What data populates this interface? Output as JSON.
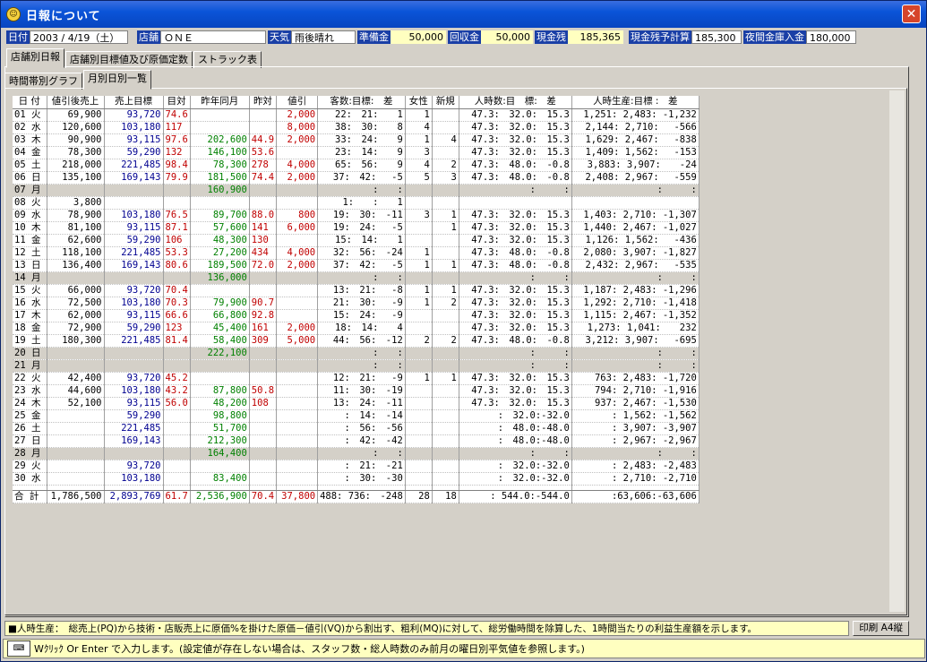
{
  "window": {
    "title": "日報について",
    "close": "✕",
    "icon": "☺"
  },
  "info": [
    {
      "label": "日付",
      "value": "2003 / 4/19（土）",
      "style": "val",
      "w": 110
    },
    {
      "label": "店舗",
      "value": "ＯＮＥ",
      "style": "val",
      "w": 118
    },
    {
      "label": "天気",
      "value": "雨後晴れ",
      "style": "val",
      "w": 72
    },
    {
      "label": "準備金",
      "value": "50,000",
      "style": "valy",
      "w": 62
    },
    {
      "label": "回収金",
      "value": "50,000",
      "style": "valy",
      "w": 58
    },
    {
      "label": "現金残",
      "value": "185,365",
      "style": "valy",
      "w": 62
    },
    {
      "label": "現金残予計算",
      "value": "185,300",
      "style": "val",
      "w": 56
    },
    {
      "label": "夜間金庫入金",
      "value": "180,000",
      "style": "val",
      "w": 56
    }
  ],
  "tabs1": [
    "店舗別日報",
    "店舗別目標値及び原価定数",
    "ストラック表"
  ],
  "tabs2": [
    "時間帯別グラフ",
    "月別日別一覧"
  ],
  "columns": [
    "日 付",
    "値引後売上",
    "売上目標",
    "目対",
    "昨年同月",
    "昨対",
    "値引",
    "客数:目標:　差",
    "女性",
    "新規",
    "人時数:目　標:　差",
    "人時生産:目標 :　差"
  ],
  "rows": [
    [
      "01 火",
      "69,900",
      "93,720",
      "74.6",
      "",
      "",
      "2,000",
      "22:　21:　　1",
      "1",
      "",
      "47.3:　32.0:　15.3",
      "1,251: 2,483: -1,232",
      ""
    ],
    [
      "02 水",
      "120,600",
      "103,180",
      "117",
      "",
      "",
      "8,000",
      "38:　30:　　8",
      "4",
      "",
      "47.3:　32.0:　15.3",
      "2,144: 2,710:　 -566",
      ""
    ],
    [
      "03 木",
      "90,900",
      "93,115",
      "97.6",
      "202,600",
      "44.9",
      "2,000",
      "33:　24:　　9",
      "1",
      "4",
      "47.3:　32.0:　15.3",
      "1,629: 2,467:　 -838",
      ""
    ],
    [
      "04 金",
      "78,300",
      "59,290",
      "132",
      "146,100",
      "53.6",
      "",
      "23:　14:　　9",
      "3",
      "",
      "47.3:　32.0:　15.3",
      "1,409: 1,562:　 -153",
      ""
    ],
    [
      "05 土",
      "218,000",
      "221,485",
      "98.4",
      "78,300",
      "278",
      "4,000",
      "65:　56:　　9",
      "4",
      "2",
      "47.3:　48.0:　-0.8",
      "3,883: 3,907:　　-24",
      ""
    ],
    [
      "06 日",
      "135,100",
      "169,143",
      "79.9",
      "181,500",
      "74.4",
      "2,000",
      "37:　42:　 -5",
      "5",
      "3",
      "47.3:　48.0:　-0.8",
      "2,408: 2,967:　 -559",
      ""
    ],
    [
      "07 月",
      "",
      "",
      "",
      "160,900",
      "",
      "",
      "　:　　:",
      "",
      "",
      "　　　:　　　:",
      "　　　:　　　:",
      "gray"
    ],
    [
      "08 火",
      "3,800",
      "",
      "",
      "",
      "",
      "",
      "1:　　:　　1",
      "",
      "",
      "",
      "",
      ""
    ],
    [
      "09 水",
      "78,900",
      "103,180",
      "76.5",
      "89,700",
      "88.0",
      "800",
      "19:　30:　-11",
      "3",
      "1",
      "47.3:　32.0:　15.3",
      "1,403: 2,710: -1,307",
      ""
    ],
    [
      "10 木",
      "81,100",
      "93,115",
      "87.1",
      "57,600",
      "141",
      "6,000",
      "19:　24:　 -5",
      "",
      "1",
      "47.3:　32.0:　15.3",
      "1,440: 2,467: -1,027",
      ""
    ],
    [
      "11 金",
      "62,600",
      "59,290",
      "106",
      "48,300",
      "130",
      "",
      "15:　14:　　1",
      "",
      "",
      "47.3:　32.0:　15.3",
      "1,126: 1,562:　 -436",
      ""
    ],
    [
      "12 土",
      "118,100",
      "221,485",
      "53.3",
      "27,200",
      "434",
      "4,000",
      "32:　56:　-24",
      "1",
      "",
      "47.3:　48.0:　-0.8",
      "2,080: 3,907: -1,827",
      ""
    ],
    [
      "13 日",
      "136,400",
      "169,143",
      "80.6",
      "189,500",
      "72.0",
      "2,000",
      "37:　42:　 -5",
      "1",
      "1",
      "47.3:　48.0:　-0.8",
      "2,432: 2,967:　 -535",
      ""
    ],
    [
      "14 月",
      "",
      "",
      "",
      "136,000",
      "",
      "",
      "　:　　:",
      "",
      "",
      "　　　:　　　:",
      "　　　:　　　:",
      "gray"
    ],
    [
      "15 火",
      "66,000",
      "93,720",
      "70.4",
      "",
      "",
      "",
      "13:　21:　 -8",
      "1",
      "1",
      "47.3:　32.0:　15.3",
      "1,187: 2,483: -1,296",
      ""
    ],
    [
      "16 水",
      "72,500",
      "103,180",
      "70.3",
      "79,900",
      "90.7",
      "",
      "21:　30:　 -9",
      "1",
      "2",
      "47.3:　32.0:　15.3",
      "1,292: 2,710: -1,418",
      ""
    ],
    [
      "17 木",
      "62,000",
      "93,115",
      "66.6",
      "66,800",
      "92.8",
      "",
      "15:　24:　 -9",
      "",
      "",
      "47.3:　32.0:　15.3",
      "1,115: 2,467: -1,352",
      ""
    ],
    [
      "18 金",
      "72,900",
      "59,290",
      "123",
      "45,400",
      "161",
      "2,000",
      "18:　14:　　4",
      "",
      "",
      "47.3:　32.0:　15.3",
      "1,273: 1,041:　　232",
      ""
    ],
    [
      "19 土",
      "180,300",
      "221,485",
      "81.4",
      "58,400",
      "309",
      "5,000",
      "44:　56:　-12",
      "2",
      "2",
      "47.3:　48.0:　-0.8",
      "3,212: 3,907:　 -695",
      ""
    ],
    [
      "20 日",
      "",
      "",
      "",
      "222,100",
      "",
      "",
      "　:　　:",
      "",
      "",
      "　　　:　　　:",
      "　　　:　　　:",
      "gray"
    ],
    [
      "21 月",
      "",
      "",
      "",
      "",
      "",
      "",
      "　:　　:",
      "",
      "",
      "　　　:　　　:",
      "　　　:　　　:",
      "gray"
    ],
    [
      "22 火",
      "42,400",
      "93,720",
      "45.2",
      "",
      "",
      "",
      "12:　21:　 -9",
      "1",
      "1",
      "47.3:　32.0:　15.3",
      "763: 2,483: -1,720",
      ""
    ],
    [
      "23 水",
      "44,600",
      "103,180",
      "43.2",
      "87,800",
      "50.8",
      "",
      "11:　30:　-19",
      "",
      "",
      "47.3:　32.0:　15.3",
      "794: 2,710: -1,916",
      ""
    ],
    [
      "24 木",
      "52,100",
      "93,115",
      "56.0",
      "48,200",
      "108",
      "",
      "13:　24:　-11",
      "",
      "",
      "47.3:　32.0:　15.3",
      "937: 2,467: -1,530",
      ""
    ],
    [
      "25 金",
      "",
      "59,290",
      "",
      "98,800",
      "",
      "",
      "　:　14:　-14",
      "",
      "",
      "　　:　32.0:-32.0",
      "　: 1,562: -1,562",
      ""
    ],
    [
      "26 土",
      "",
      "221,485",
      "",
      "51,700",
      "",
      "",
      "　:　56:　-56",
      "",
      "",
      "　　:　48.0:-48.0",
      "　: 3,907: -3,907",
      ""
    ],
    [
      "27 日",
      "",
      "169,143",
      "",
      "212,300",
      "",
      "",
      "　:　42:　-42",
      "",
      "",
      "　　:　48.0:-48.0",
      "　: 2,967: -2,967",
      ""
    ],
    [
      "28 月",
      "",
      "",
      "",
      "164,400",
      "",
      "",
      "　:　　:",
      "",
      "",
      "　　　:　　　:",
      "　　　:　　　:",
      "gray"
    ],
    [
      "29 火",
      "",
      "93,720",
      "",
      "",
      "",
      "",
      "　:　21:　-21",
      "",
      "",
      "　　:　32.0:-32.0",
      "　: 2,483: -2,483",
      ""
    ],
    [
      "30 水",
      "",
      "103,180",
      "",
      "83,400",
      "",
      "",
      "　:　30:　-30",
      "",
      "",
      "　　:　32.0:-32.0",
      "　: 2,710: -2,710",
      ""
    ]
  ],
  "total": [
    "合 計",
    "1,786,500",
    "2,893,769",
    "61.7",
    "2,536,900",
    "70.4",
    "37,800",
    "488: 736:　-248",
    "28",
    "18",
    "　: 544.0:-544.0",
    ":63,606:-63,606"
  ],
  "status": {
    "text": "■人時生産：　総売上(PQ)から技術・店販売上に原価%を掛けた原価－値引(VQ)から割出す、粗利(MQ)に対して、総労働時間を除算した、1時間当たりの利益生産額を示します。",
    "print": "印刷 A4縦"
  },
  "hint": "Wｸﾘｯｸ Or Enter で入力します。(設定値が存在しない場合は、スタッフ数・総人時数のみ前月の曜日別平気値を参照します。)",
  "kbd_icon": "⌨"
}
